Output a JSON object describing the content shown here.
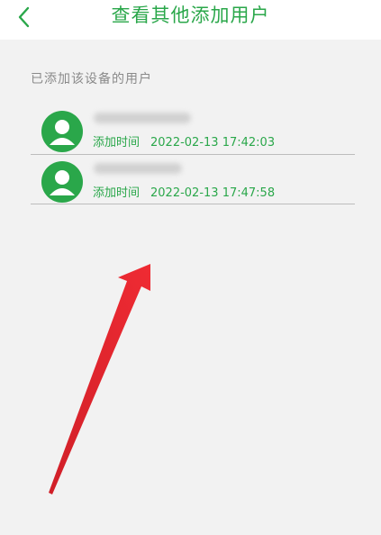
{
  "header": {
    "title": "查看其他添加用户"
  },
  "section": {
    "label": "已添加该设备的用户"
  },
  "users": [
    {
      "added_label": "添加时间",
      "added_time": "2022-02-13 17:42:03"
    },
    {
      "added_label": "添加时间",
      "added_time": "2022-02-13 17:47:58"
    }
  ],
  "colors": {
    "accent": "#2aa74a",
    "background": "#f2f2f2",
    "annotation_arrow": "#e3222b"
  }
}
